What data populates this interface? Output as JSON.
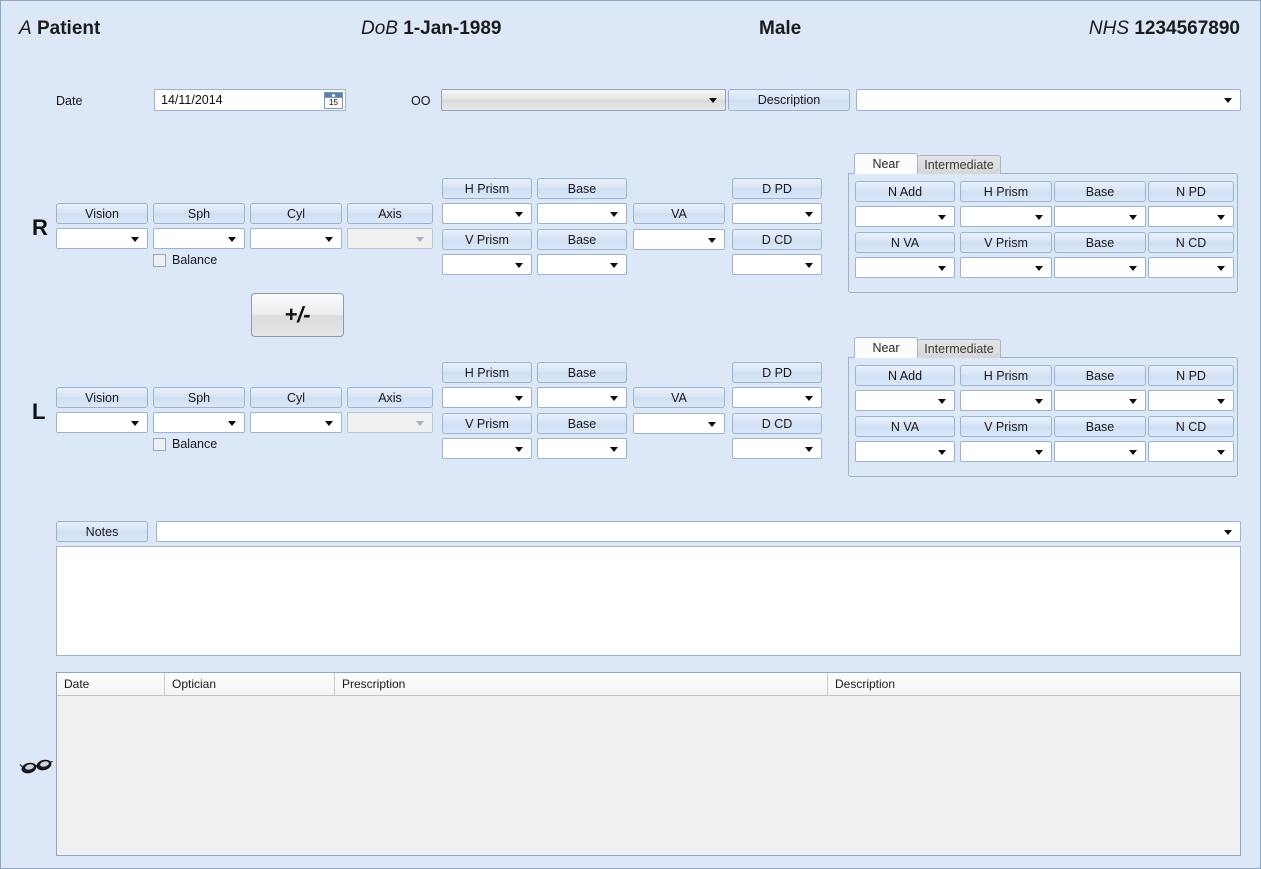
{
  "header": {
    "name_prefix": "A",
    "name": "Patient",
    "dob_label": "DoB",
    "dob_value": "1-Jan-1989",
    "sex": "Male",
    "nhs_label": "NHS",
    "nhs_value": "1234567890"
  },
  "toolbar": {
    "date_label": "Date",
    "date_value": "14/11/2014",
    "calendar_day": "15",
    "oo_label": "OO",
    "oo_value": "",
    "description_label": "Description",
    "description_value": ""
  },
  "right_eye": {
    "eye_letter": "R",
    "balance_label": "Balance",
    "balance_checked": false,
    "dist_labels": [
      "Vision",
      "Sph",
      "Cyl",
      "Axis"
    ],
    "dist_values": [
      "",
      "",
      "",
      ""
    ],
    "axis_disabled": true,
    "prism_labels": {
      "h_prism": "H Prism",
      "h_base": "Base",
      "v_prism": "V Prism",
      "v_base": "Base",
      "va": "VA",
      "d_pd": "D PD",
      "d_cd": "D CD"
    },
    "prism_values": {
      "h_prism": "",
      "h_base": "",
      "v_prism": "",
      "v_base": "",
      "va": "",
      "d_pd": "",
      "d_cd": ""
    },
    "near_panel": {
      "tabs": [
        "Near",
        "Intermediate"
      ],
      "active_tab": "Near",
      "labels": {
        "n_add": "N Add",
        "h_prism": "H Prism",
        "h_base": "Base",
        "n_pd": "N PD",
        "n_va": "N VA",
        "v_prism": "V Prism",
        "v_base": "Base",
        "n_cd": "N CD"
      },
      "values": {
        "n_add": "",
        "h_prism": "",
        "h_base": "",
        "n_pd": "",
        "n_va": "",
        "v_prism": "",
        "v_base": "",
        "n_cd": ""
      }
    }
  },
  "left_eye": {
    "eye_letter": "L",
    "balance_label": "Balance",
    "balance_checked": false,
    "dist_labels": [
      "Vision",
      "Sph",
      "Cyl",
      "Axis"
    ],
    "dist_values": [
      "",
      "",
      "",
      ""
    ],
    "axis_disabled": true,
    "prism_labels": {
      "h_prism": "H Prism",
      "h_base": "Base",
      "v_prism": "V Prism",
      "v_base": "Base",
      "va": "VA",
      "d_pd": "D PD",
      "d_cd": "D CD"
    },
    "prism_values": {
      "h_prism": "",
      "h_base": "",
      "v_prism": "",
      "v_base": "",
      "va": "",
      "d_pd": "",
      "d_cd": ""
    },
    "near_panel": {
      "tabs": [
        "Near",
        "Intermediate"
      ],
      "active_tab": "Near",
      "labels": {
        "n_add": "N Add",
        "h_prism": "H Prism",
        "h_base": "Base",
        "n_pd": "N PD",
        "n_va": "N VA",
        "v_prism": "V Prism",
        "v_base": "Base",
        "n_cd": "N CD"
      },
      "values": {
        "n_add": "",
        "h_prism": "",
        "h_base": "",
        "n_pd": "",
        "n_va": "",
        "v_prism": "",
        "v_base": "",
        "n_cd": ""
      }
    }
  },
  "sign_toggle": {
    "label": "+/-"
  },
  "notes": {
    "label": "Notes",
    "combo_value": "",
    "text_value": ""
  },
  "history": {
    "columns": [
      "Date",
      "Optician",
      "Prescription",
      "Description"
    ],
    "rows": []
  },
  "icons": {
    "glasses": "glasses-icon",
    "calendar": "calendar-icon"
  },
  "colors": {
    "form_background": "#dce7f7",
    "label_button": "#d7e4f6",
    "field_border": "#9cb3cd",
    "grid_body": "#f0f0f0",
    "disabled_field": "#f0f0f0"
  }
}
